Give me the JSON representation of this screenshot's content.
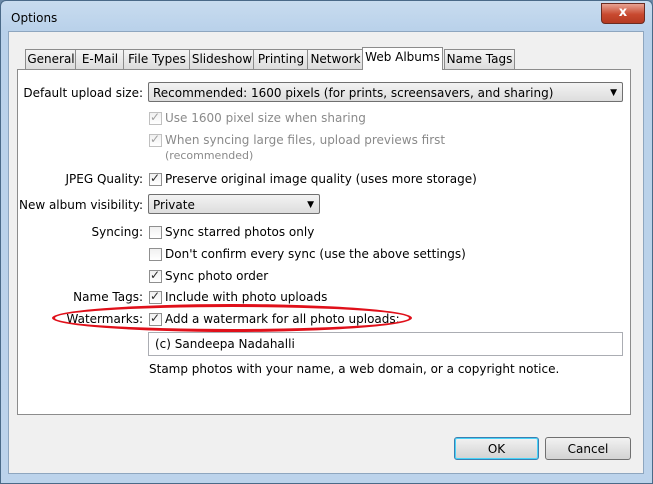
{
  "window": {
    "title": "Options",
    "close_label": "x"
  },
  "tabs": [
    "General",
    "E-Mail",
    "File Types",
    "Slideshow",
    "Printing",
    "Network",
    "Web Albums",
    "Name Tags"
  ],
  "active_tab": "Web Albums",
  "default_upload_size": {
    "label": "Default upload size:",
    "value": "Recommended: 1600 pixels (for prints, screensavers, and sharing)"
  },
  "options": {
    "use_1600": "Use 1600 pixel size when sharing",
    "sync_large_1": "When syncing large files, upload previews first",
    "sync_large_2": "(recommended)"
  },
  "jpeg_quality": {
    "label": "JPEG Quality:",
    "option": "Preserve original image quality (uses more storage)"
  },
  "album_visibility": {
    "label": "New album visibility:",
    "value": "Private"
  },
  "syncing": {
    "label": "Syncing:",
    "starred": "Sync starred photos only",
    "dont_confirm": "Don't confirm every sync (use the above settings)",
    "order": "Sync photo order"
  },
  "name_tags": {
    "label": "Name Tags:",
    "option": "Include with photo uploads"
  },
  "watermarks": {
    "label": "Watermarks:",
    "option": "Add a watermark for all photo uploads:",
    "text_value": "(c) Sandeepa Nadahalli",
    "hint": "Stamp photos with your name, a web domain, or a copyright notice."
  },
  "buttons": {
    "ok": "OK",
    "cancel": "Cancel"
  },
  "colors": {
    "highlight_ellipse": "#e0101a",
    "close_button": "#c8492f"
  }
}
